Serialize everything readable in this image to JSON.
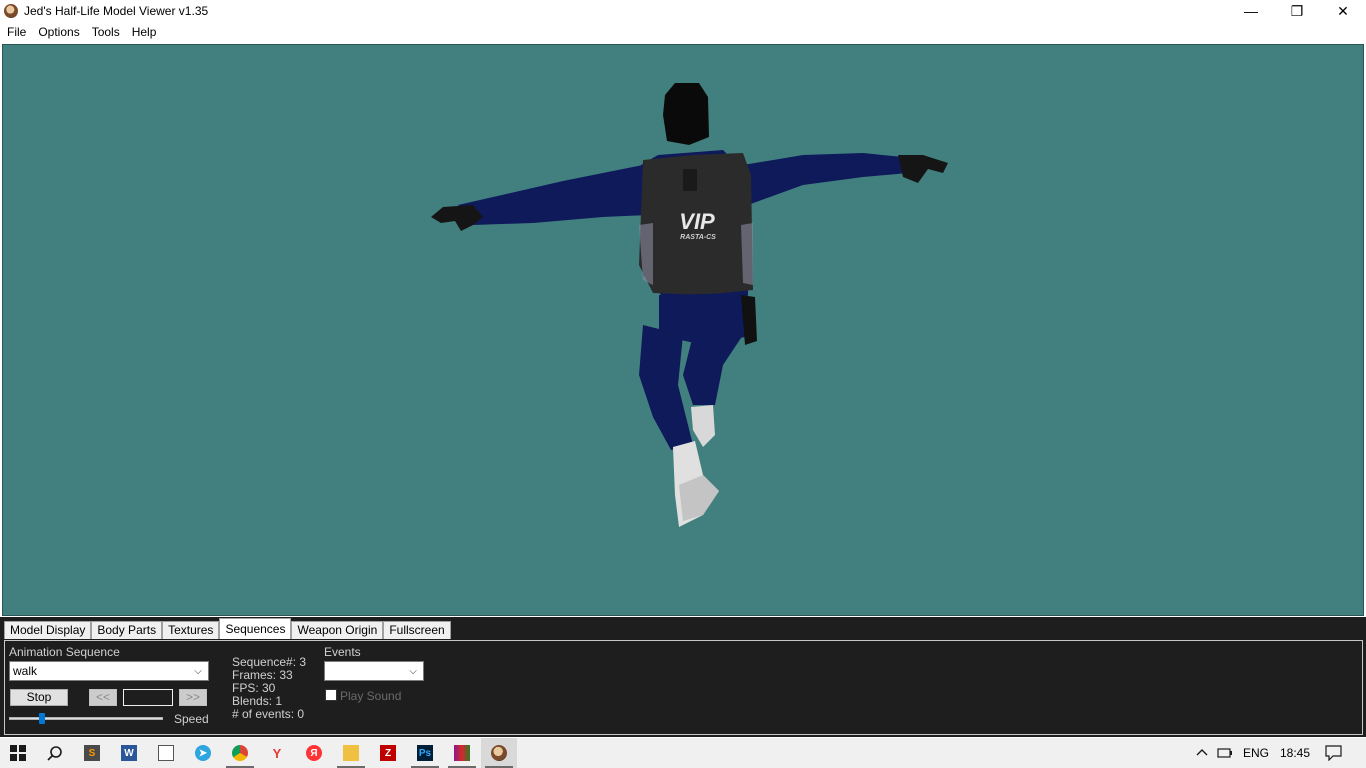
{
  "window": {
    "title": "Jed's Half-Life Model Viewer v1.35",
    "minimize": "—",
    "maximize": "❐",
    "close": "✕"
  },
  "menu": [
    "File",
    "Options",
    "Tools",
    "Help"
  ],
  "viewport": {
    "background": "#428080",
    "vest_text": "VIP",
    "vest_subtext": "RASTA-CS"
  },
  "tabs": [
    "Model Display",
    "Body Parts",
    "Textures",
    "Sequences",
    "Weapon Origin",
    "Fullscreen"
  ],
  "active_tab": "Sequences",
  "sequences": {
    "animation_label": "Animation Sequence",
    "animation_value": "walk",
    "stop_label": "Stop",
    "prev_label": "<<",
    "next_label": ">>",
    "speed_label": "Speed",
    "speed_value": 0.2,
    "info": {
      "sequence": "Sequence#: 3",
      "frames": "Frames: 33",
      "fps": "FPS: 30",
      "blends": "Blends: 1",
      "events": "# of events: 0"
    },
    "events_label": "Events",
    "events_value": "",
    "play_sound_label": "Play Sound",
    "play_sound_checked": false
  },
  "taskbar": {
    "apps": [
      "start-icon",
      "search-icon",
      "sublime-icon",
      "word-icon",
      "file-icon",
      "telegram-icon",
      "chrome-icon",
      "yandex-browser-icon",
      "yandex-icon",
      "file-explorer-icon",
      "filezilla-icon",
      "photoshop-icon",
      "winrar-icon",
      "hlmv-icon"
    ],
    "language": "ENG",
    "time": "18:45"
  }
}
